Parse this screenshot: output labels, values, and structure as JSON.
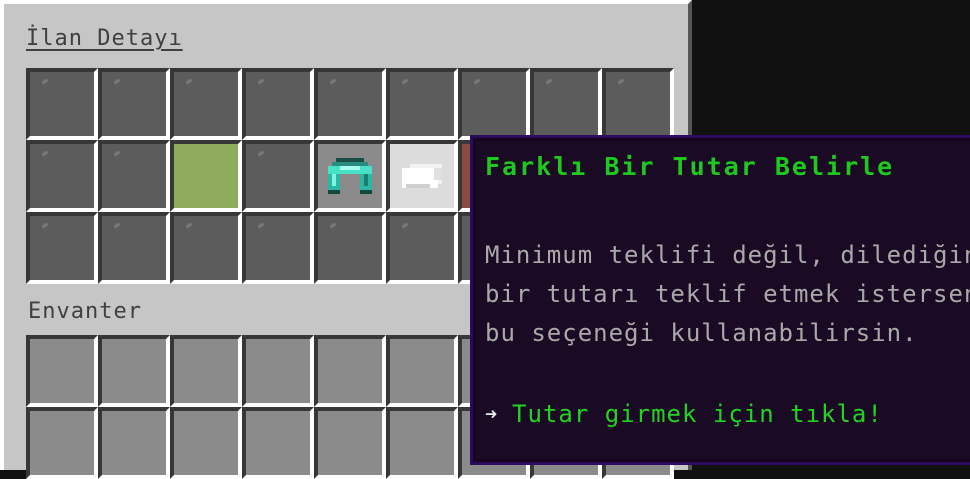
{
  "window": {
    "title": "İlan Detayı",
    "inventory_label": "Envanter"
  },
  "icons": {
    "helmet": "diamond-helmet-icon",
    "paper": "paper-icon"
  },
  "tooltip": {
    "title": "Farklı Bir Tutar Belirle",
    "lines": [
      "Minimum teklifi değil, dilediğin",
      "bir tutarı teklif etmek istersen",
      "bu seçeneği kullanabilirsin."
    ],
    "action": "Tutar girmek için tıkla!",
    "colors": {
      "title": "#1ec81e",
      "text": "#a9a9a9",
      "action": "#22d322",
      "background": "#1b0a24"
    }
  }
}
